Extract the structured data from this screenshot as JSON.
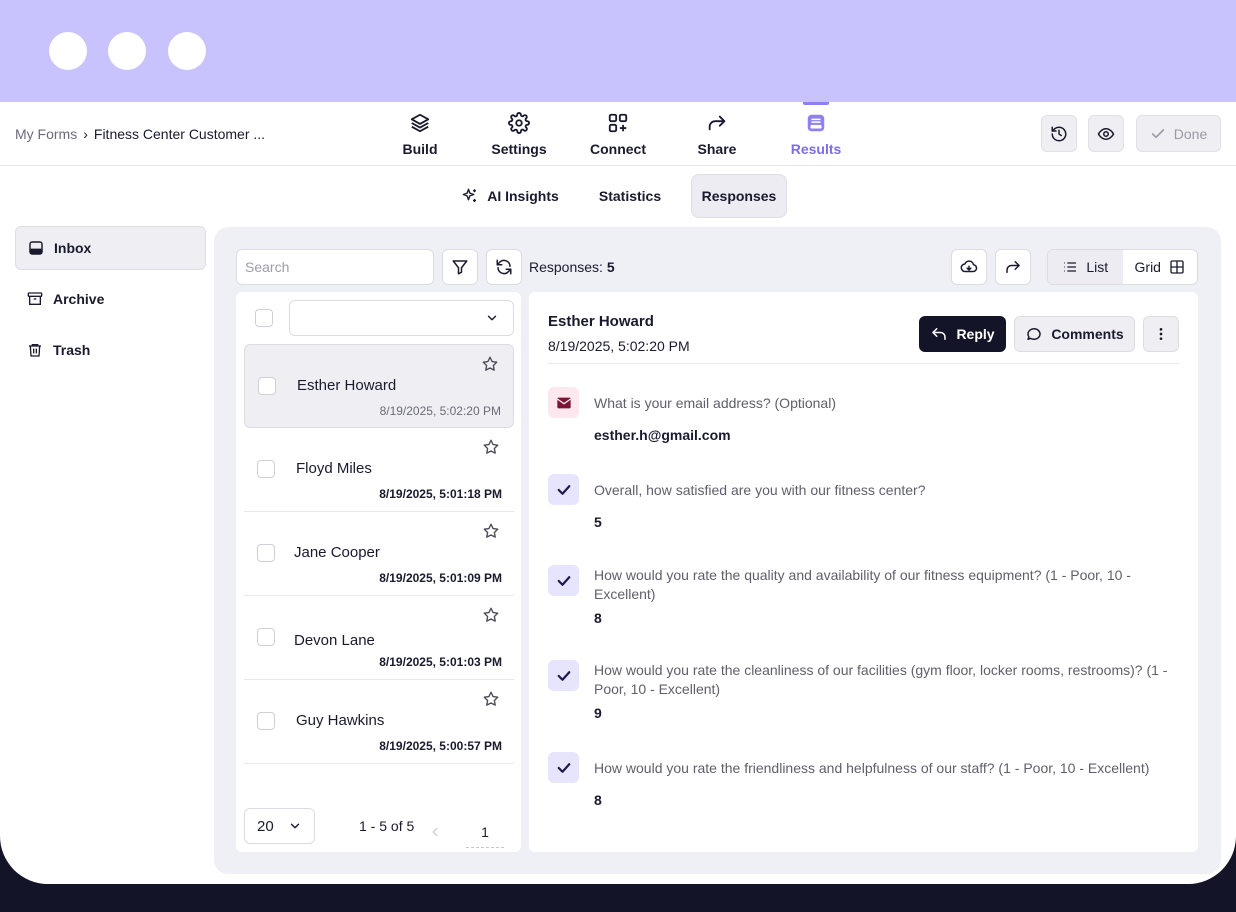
{
  "breadcrumb": {
    "root": "My Forms",
    "separator": "›",
    "current": "Fitness Center Customer ..."
  },
  "nav_tabs": [
    {
      "label": "Build",
      "icon": "layers-icon"
    },
    {
      "label": "Settings",
      "icon": "gear-icon"
    },
    {
      "label": "Connect",
      "icon": "apps-plus-icon"
    },
    {
      "label": "Share",
      "icon": "share-arrow-icon"
    },
    {
      "label": "Results",
      "icon": "inbox-icon",
      "active": true
    }
  ],
  "toolbar": {
    "history_icon": "history-icon",
    "preview_icon": "eye-icon",
    "done_label": "Done"
  },
  "sub_tabs": [
    {
      "label": "AI Insights",
      "icon": "sparkle-icon"
    },
    {
      "label": "Statistics"
    },
    {
      "label": "Responses",
      "active": true
    }
  ],
  "sidebar": [
    {
      "label": "Inbox",
      "icon": "inbox-icon",
      "active": true
    },
    {
      "label": "Archive",
      "icon": "archive-icon"
    },
    {
      "label": "Trash",
      "icon": "trash-icon"
    }
  ],
  "list_toolbar": {
    "search_placeholder": "Search",
    "responses_label": "Responses:",
    "responses_count": "5",
    "view_list": "List",
    "view_grid": "Grid"
  },
  "responses": [
    {
      "name": "Esther Howard",
      "time": "8/19/2025, 5:02:20 PM",
      "selected": true
    },
    {
      "name": "Floyd Miles",
      "time": "8/19/2025, 5:01:18 PM"
    },
    {
      "name": "Jane Cooper",
      "time": "8/19/2025, 5:01:09 PM"
    },
    {
      "name": "Devon Lane",
      "time": "8/19/2025, 5:01:03 PM"
    },
    {
      "name": "Guy Hawkins",
      "time": "8/19/2025, 5:00:57 PM"
    }
  ],
  "pagination": {
    "page_size": "20",
    "range": "1 - 5 of 5",
    "page": "1"
  },
  "detail": {
    "name": "Esther Howard",
    "date": "8/19/2025, 5:02:20 PM",
    "reply_label": "Reply",
    "comments_label": "Comments",
    "answers": [
      {
        "question": "What is your email address? (Optional)",
        "answer": "esther.h@gmail.com",
        "type": "email"
      },
      {
        "question": "Overall, how satisfied are you with our fitness center?",
        "answer": "5",
        "type": "check"
      },
      {
        "question": "How would you rate the quality and availability of our fitness equipment? (1 - Poor, 10 - Excellent)",
        "answer": "8",
        "type": "check"
      },
      {
        "question": "How would you rate the cleanliness of our facilities (gym floor, locker rooms, restrooms)? (1 - Poor, 10 - Excellent)",
        "answer": "9",
        "type": "check"
      },
      {
        "question": "How would you rate the friendliness and helpfulness of our staff? (1 - Poor, 10 - Excellent)",
        "answer": "8",
        "type": "check"
      }
    ]
  },
  "colors": {
    "window_bar": "#c8c2fd",
    "accent": "#7c6cf2",
    "dark": "#141428",
    "panel_bg": "#eff0f5",
    "email_icon_bg": "#fde8ef",
    "check_icon_bg": "#e7e4fd"
  }
}
